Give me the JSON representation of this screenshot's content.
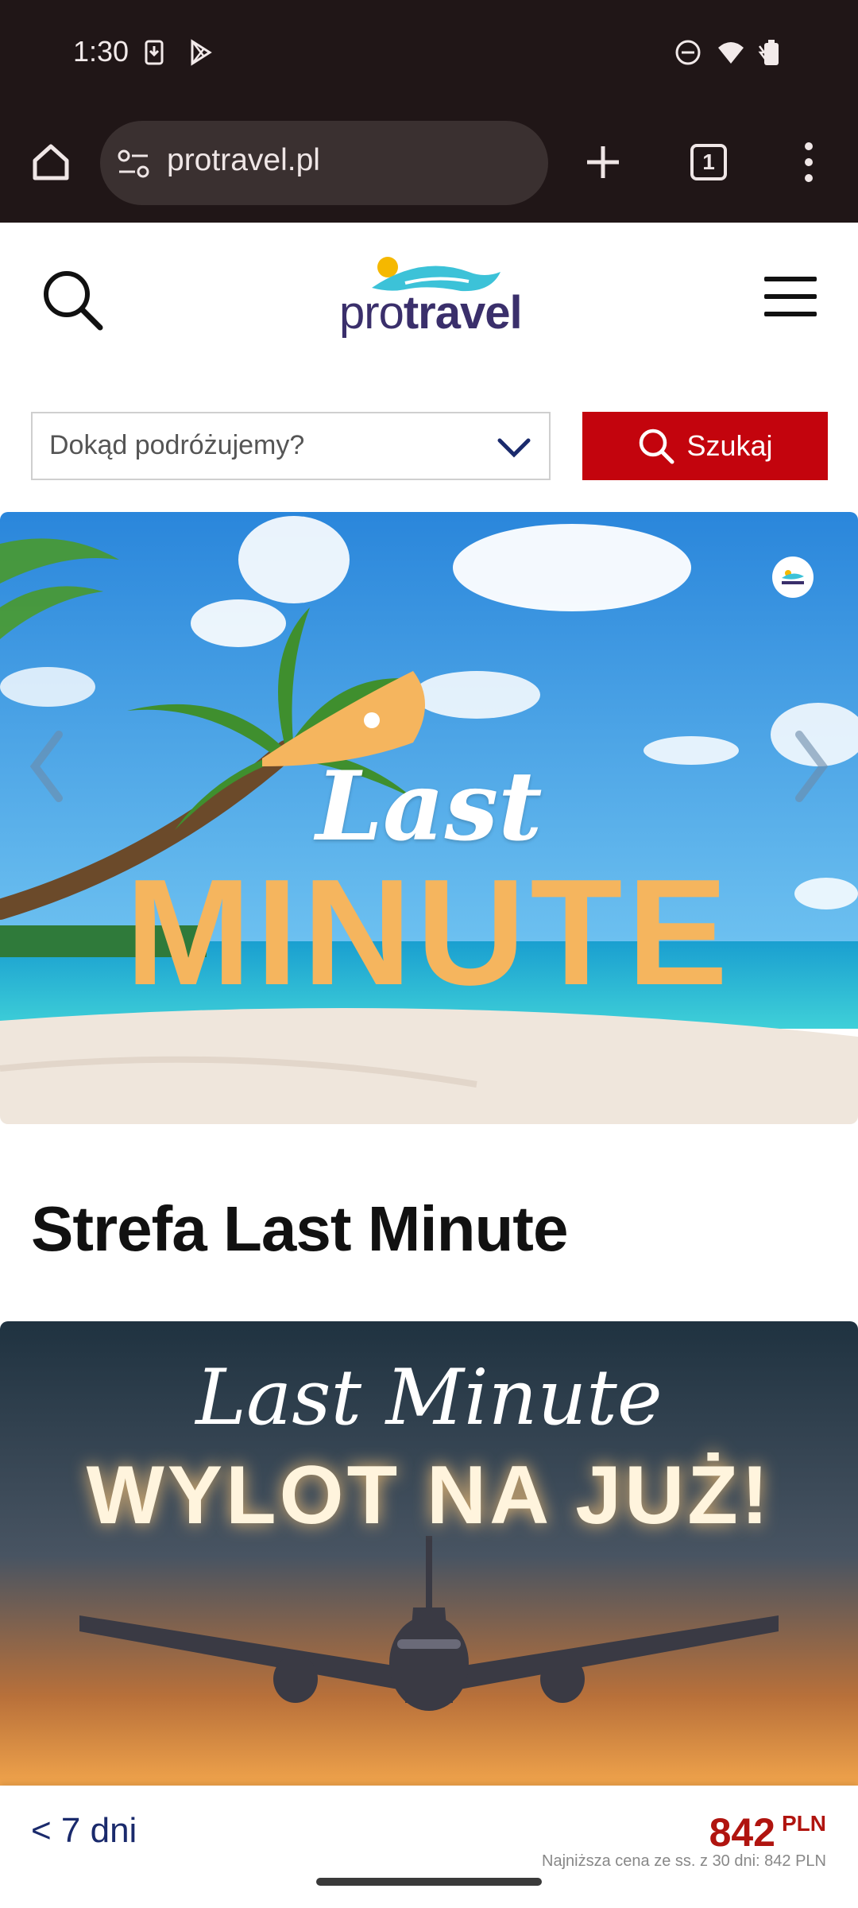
{
  "status_bar": {
    "time": "1:30",
    "icons_left": [
      "download-icon",
      "play-store-icon"
    ],
    "icons_right": [
      "dnd-icon",
      "wifi-icon",
      "battery-icon"
    ]
  },
  "browser": {
    "url": "protravel.pl",
    "tab_count": "1",
    "icons": [
      "home-icon",
      "site-settings-icon",
      "new-tab-icon",
      "tabs-icon",
      "more-icon"
    ]
  },
  "site_header": {
    "logo_light": "pro",
    "logo_bold": "travel",
    "icons": [
      "search-icon",
      "menu-icon"
    ]
  },
  "search": {
    "destination_placeholder": "Dokąd podróżujemy?",
    "button_label": "Szukaj"
  },
  "hero": {
    "line1": "Last",
    "line2": "MINUTE",
    "colors": {
      "sky": "#2f8fe0",
      "sea": "#23b5d6",
      "sand": "#efe6dc",
      "accent": "#f5b55e"
    }
  },
  "section": {
    "title": "Strefa Last Minute"
  },
  "promo": {
    "script": "Last Minute",
    "headline": "WYLOT NA JUŻ!"
  },
  "bottom_bar": {
    "days": "< 7 dni",
    "price": "842",
    "currency": "PLN",
    "note": "Najniższa cena ze ss. z 30 dni: 842 PLN"
  },
  "colors": {
    "brand_red": "#c3040d",
    "brand_navy": "#3a2f6b",
    "chrome_bg": "#201617"
  }
}
